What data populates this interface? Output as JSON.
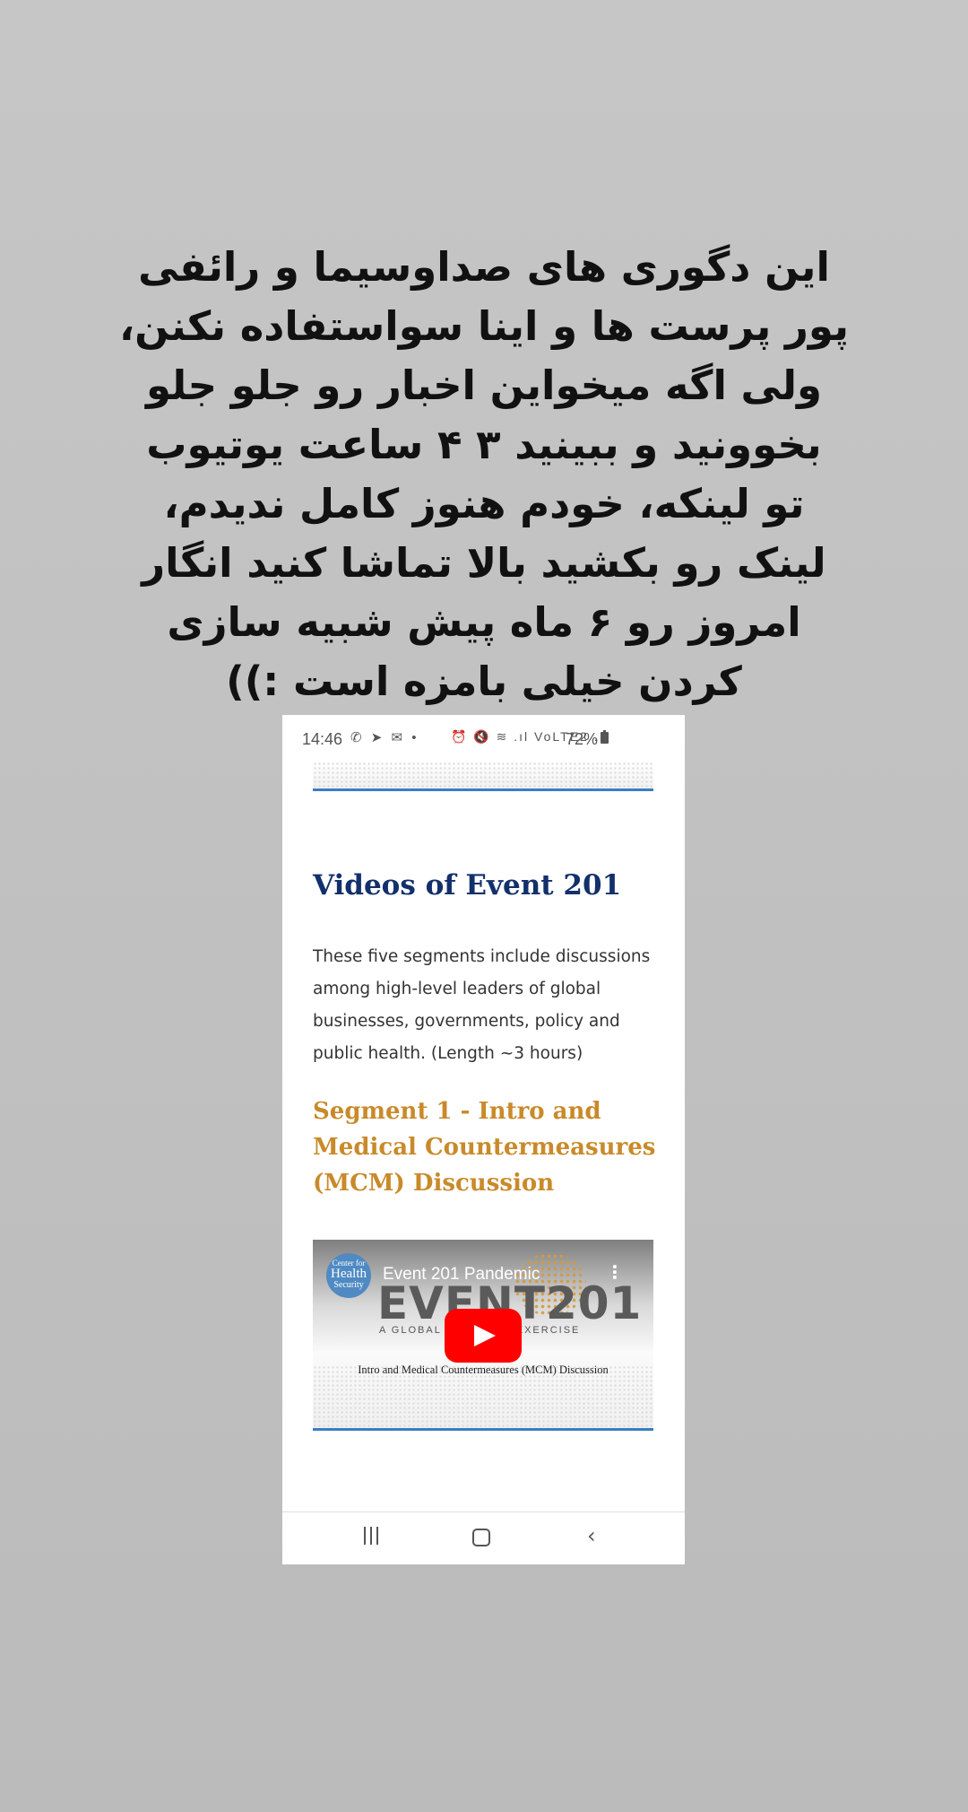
{
  "caption": {
    "lines": [
      "این دگوری های صداوسیما و رائفی",
      "پور پرست ها و اینا سواستفاده نکنن،",
      "ولی اگه میخواین اخبار رو جلو جلو",
      "بخوونید و ببینید ۳ ۴ ساعت یوتیوب",
      "تو لینکه، خودم هنوز کامل ندیدم،",
      "لینک رو بکشید بالا تماشا کنید انگار",
      "امروز رو ۶ ماه پیش شبیه سازی",
      "کردن خیلی بامزه است :))"
    ]
  },
  "status_bar": {
    "time": "14:46",
    "left_icons": [
      "whatsapp-icon",
      "telegram-icon",
      "mail-icon",
      "dot"
    ],
    "left_icons_text": "✆ ➤ ✉ •",
    "right_icons": [
      "alarm-icon",
      "mute-icon",
      "wifi-icon",
      "signal-icon",
      "volte-lte2-icon",
      "signal-icon"
    ],
    "right_icons_text": "⏰ 🔇 ≋ .ıl VoLTE2 .ıl",
    "battery": "72%"
  },
  "page": {
    "title": "Videos of Event 201",
    "intro_lines": [
      "These five segments include discussions",
      "among high-level leaders of global",
      "businesses, governments, policy and",
      "public health. (Length ~3 hours)"
    ],
    "segment_title_lines": [
      "Segment 1 - Intro and",
      "Medical Countermeasures",
      "(MCM) Discussion"
    ]
  },
  "video": {
    "channel_badge": [
      "Center for",
      "Health",
      "Security"
    ],
    "title": "Event 201 Pandemic",
    "logo_word": "EVENT201",
    "logo_subtitle": "A GLOBAL PANDEMIC EXERCISE",
    "subtitle": "Intro and Medical Countermeasures (MCM) Discussion",
    "menu_icon": "⋮"
  },
  "nav_bar": {
    "back_glyph": "‹"
  },
  "colors": {
    "title_blue": "#12306b",
    "segment_orange": "#c98a2a",
    "rule_blue": "#3a7ec2",
    "youtube_red": "#ff0000"
  }
}
